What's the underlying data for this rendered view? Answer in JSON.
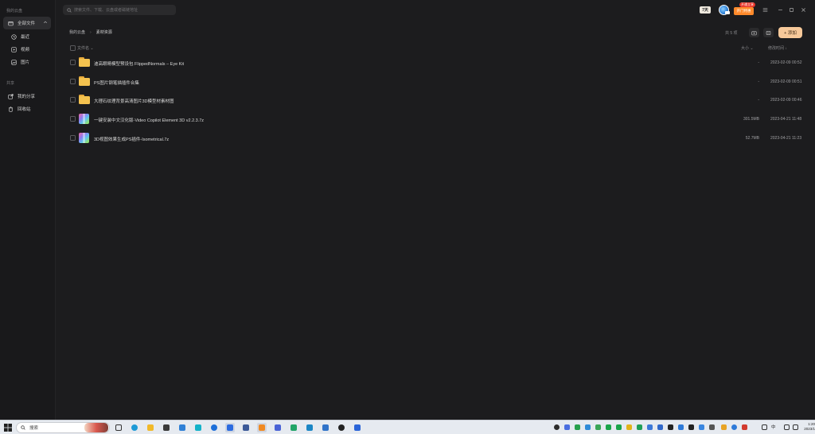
{
  "sidebar": {
    "group_cloud": "我的云盘",
    "items": [
      {
        "label": "全部文件",
        "icon": "folder-icon",
        "active": true
      },
      {
        "label": "最近",
        "icon": "clock-icon"
      },
      {
        "label": "视频",
        "icon": "video-icon"
      },
      {
        "label": "图片",
        "icon": "image-icon"
      }
    ],
    "group_share": "共享",
    "share_items": [
      {
        "label": "我的分享",
        "icon": "share-icon"
      },
      {
        "label": "回收站",
        "icon": "trash-icon"
      }
    ]
  },
  "search": {
    "placeholder": "搜索文件、下载、云盘或者磁链地址"
  },
  "topbar": {
    "vip_label": "7天",
    "promo_label": "开门特惠",
    "promo_tag": "开通立享"
  },
  "breadcrumb": {
    "root": "我的云盘",
    "current": "素材资源"
  },
  "toolbar": {
    "count_label": "共 5 项",
    "add_label": "+ 添加"
  },
  "table": {
    "col_name": "文件名",
    "col_size": "大小",
    "col_time": "修改时间",
    "rows": [
      {
        "name": "迪高眼睛模型预设包 FlippedNormals – Eye Kit",
        "size": "-",
        "time": "2023-02-09 00:52",
        "type": "folder"
      },
      {
        "name": "PS图片钢笔描插件合集",
        "size": "-",
        "time": "2023-02-09 00:51",
        "type": "folder"
      },
      {
        "name": "大理石纹理背景高清图片3D模型材素材图",
        "size": "-",
        "time": "2023-02-09 00:46",
        "type": "folder"
      },
      {
        "name": "一键安装中文汉化版-Video Copilot Element 3D v2.2.3.7z",
        "size": "301.5MB",
        "time": "2023-04-21 11:48",
        "type": "archive"
      },
      {
        "name": "3D视图效果生成PS插件-Isometrical.7z",
        "size": "52.7MB",
        "time": "2023-04-21 11:23",
        "type": "archive"
      }
    ]
  },
  "taskbar": {
    "search_label": "搜索",
    "ime_label": "中",
    "clock_time": "1:20",
    "clock_date": "2023/1"
  }
}
